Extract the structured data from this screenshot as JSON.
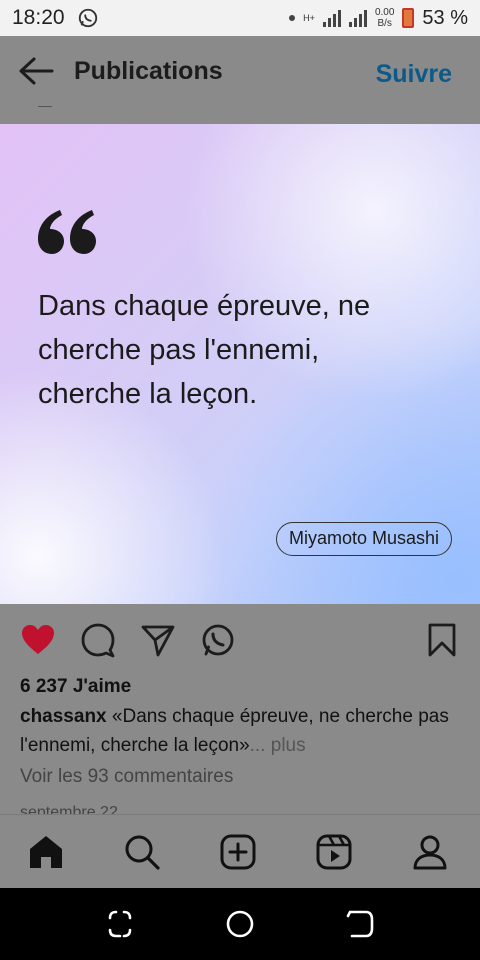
{
  "status_bar": {
    "time": "18:20",
    "network_type": "H+",
    "network_speed_value": "0.00",
    "network_speed_unit": "B/s",
    "battery_percent": "53 %"
  },
  "header": {
    "title": "Publications",
    "follow_label": "Suivre"
  },
  "post": {
    "quote_lines": [
      "Dans chaque épreuve, ne",
      "cherche pas l'ennemi,",
      "cherche la leçon."
    ],
    "author": "Miyamoto Musashi",
    "likes": "6 237 J'aime",
    "username": "chassanx",
    "caption_text": " «Dans chaque épreuve, ne cherche pas l'ennemi, cherche la leçon»",
    "caption_more": "... plus",
    "comments_link": "Voir les 93 commentaires",
    "date": "septembre 22"
  },
  "colors": {
    "like_red": "#c0112e",
    "follow_blue": "#0c5a8a",
    "overlay_grey": "#8a8a8a"
  },
  "icons": {
    "actions": [
      "heart-icon",
      "comment-icon",
      "send-icon",
      "whatsapp-icon",
      "bookmark-icon"
    ],
    "nav": [
      "home-icon",
      "search-icon",
      "add-post-icon",
      "reels-icon",
      "profile-icon"
    ]
  }
}
